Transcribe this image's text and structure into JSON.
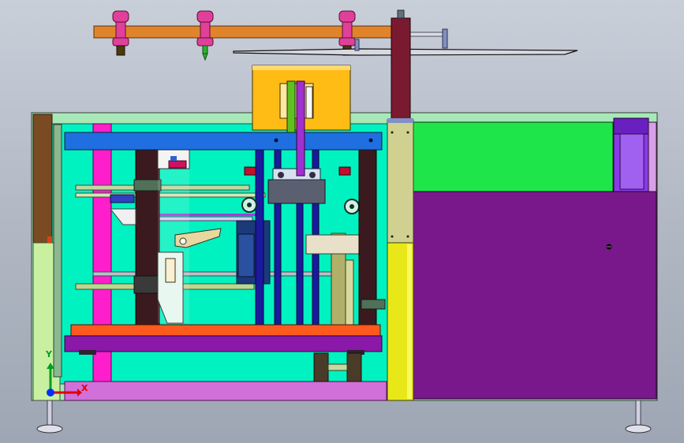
{
  "viewport": {
    "background": "#b9c0cc",
    "triad": {
      "x_label": "X",
      "y_label": "Y",
      "x_color": "#e00000",
      "y_color": "#00a020",
      "z_color": "#0030ff"
    }
  },
  "colors": {
    "cabinet_fill": "#00f2c0",
    "cabinet_frame": "#a8e8b8",
    "top_bar": "#e0842c",
    "knob": "#e0409a",
    "cross_beam": "#1f6fe0",
    "housing": "#ffbc14",
    "green_panel": "#1ee64a",
    "purple_panel": "#78188a",
    "right_column": "#e8e818",
    "column_top": "#d0d090",
    "tall_column": "#7a1a30",
    "motor": "#8a3ae6",
    "bottom_beam": "#8a18a8",
    "base_plate": "#d070d8",
    "orange_plate": "#ff5a1e",
    "magenta_rail": "#ff1ecc",
    "dark_column": "#3a1a1e",
    "navy_shaft": "#1a1a9e",
    "shaft": "#b8d890",
    "khaki_column": "#b0b06a",
    "brown_side": "#7a4a22",
    "light_green": "#c8f0a0",
    "white_part": "#f4f4f4",
    "arm": "#e8d8a0"
  }
}
